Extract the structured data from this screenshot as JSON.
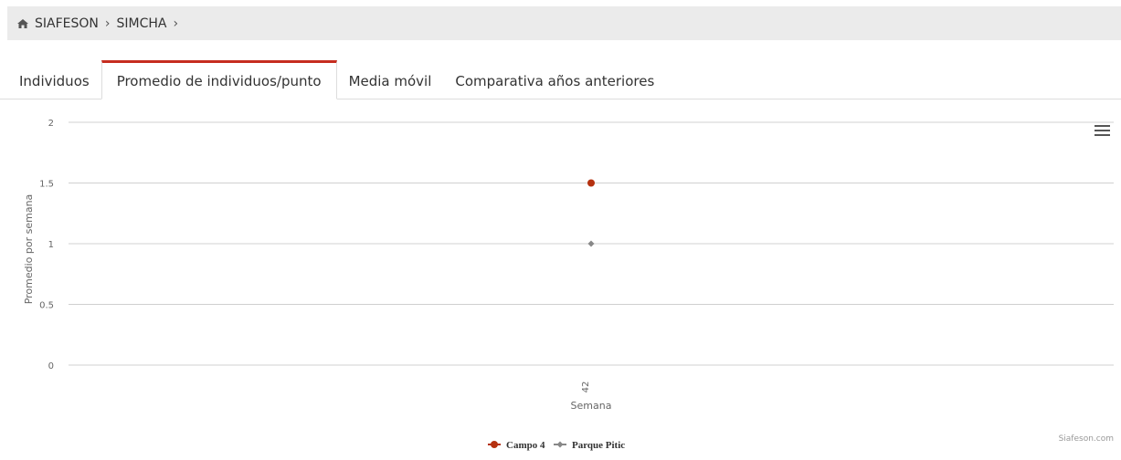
{
  "breadcrumb": {
    "icon": "home-icon",
    "items": [
      "SIAFESON",
      "SIMCHA"
    ],
    "separator": "›"
  },
  "tabs": [
    {
      "label": "Individuos",
      "active": false
    },
    {
      "label": "Promedio de individuos/punto",
      "active": true
    },
    {
      "label": "Media móvil",
      "active": false
    },
    {
      "label": "Comparativa años anteriores",
      "active": false
    }
  ],
  "chart_data": {
    "type": "line",
    "categories": [
      "42"
    ],
    "xlabel": "Semana",
    "ylabel": "Promedio por semana",
    "ylim": [
      0,
      2
    ],
    "yticks": [
      "0",
      "0.5",
      "1",
      "1.5",
      "2"
    ],
    "grid": true,
    "legend_position": "bottom-center",
    "series": [
      {
        "name": "Campo 4",
        "values": [
          1.5
        ],
        "color": "#b5310f",
        "marker": "circle"
      },
      {
        "name": "Parque Pitic",
        "values": [
          1
        ],
        "color": "#888888",
        "marker": "diamond"
      }
    ],
    "credits": "Siafeson.com"
  },
  "icons": {
    "menu": "hamburger-menu-icon"
  }
}
